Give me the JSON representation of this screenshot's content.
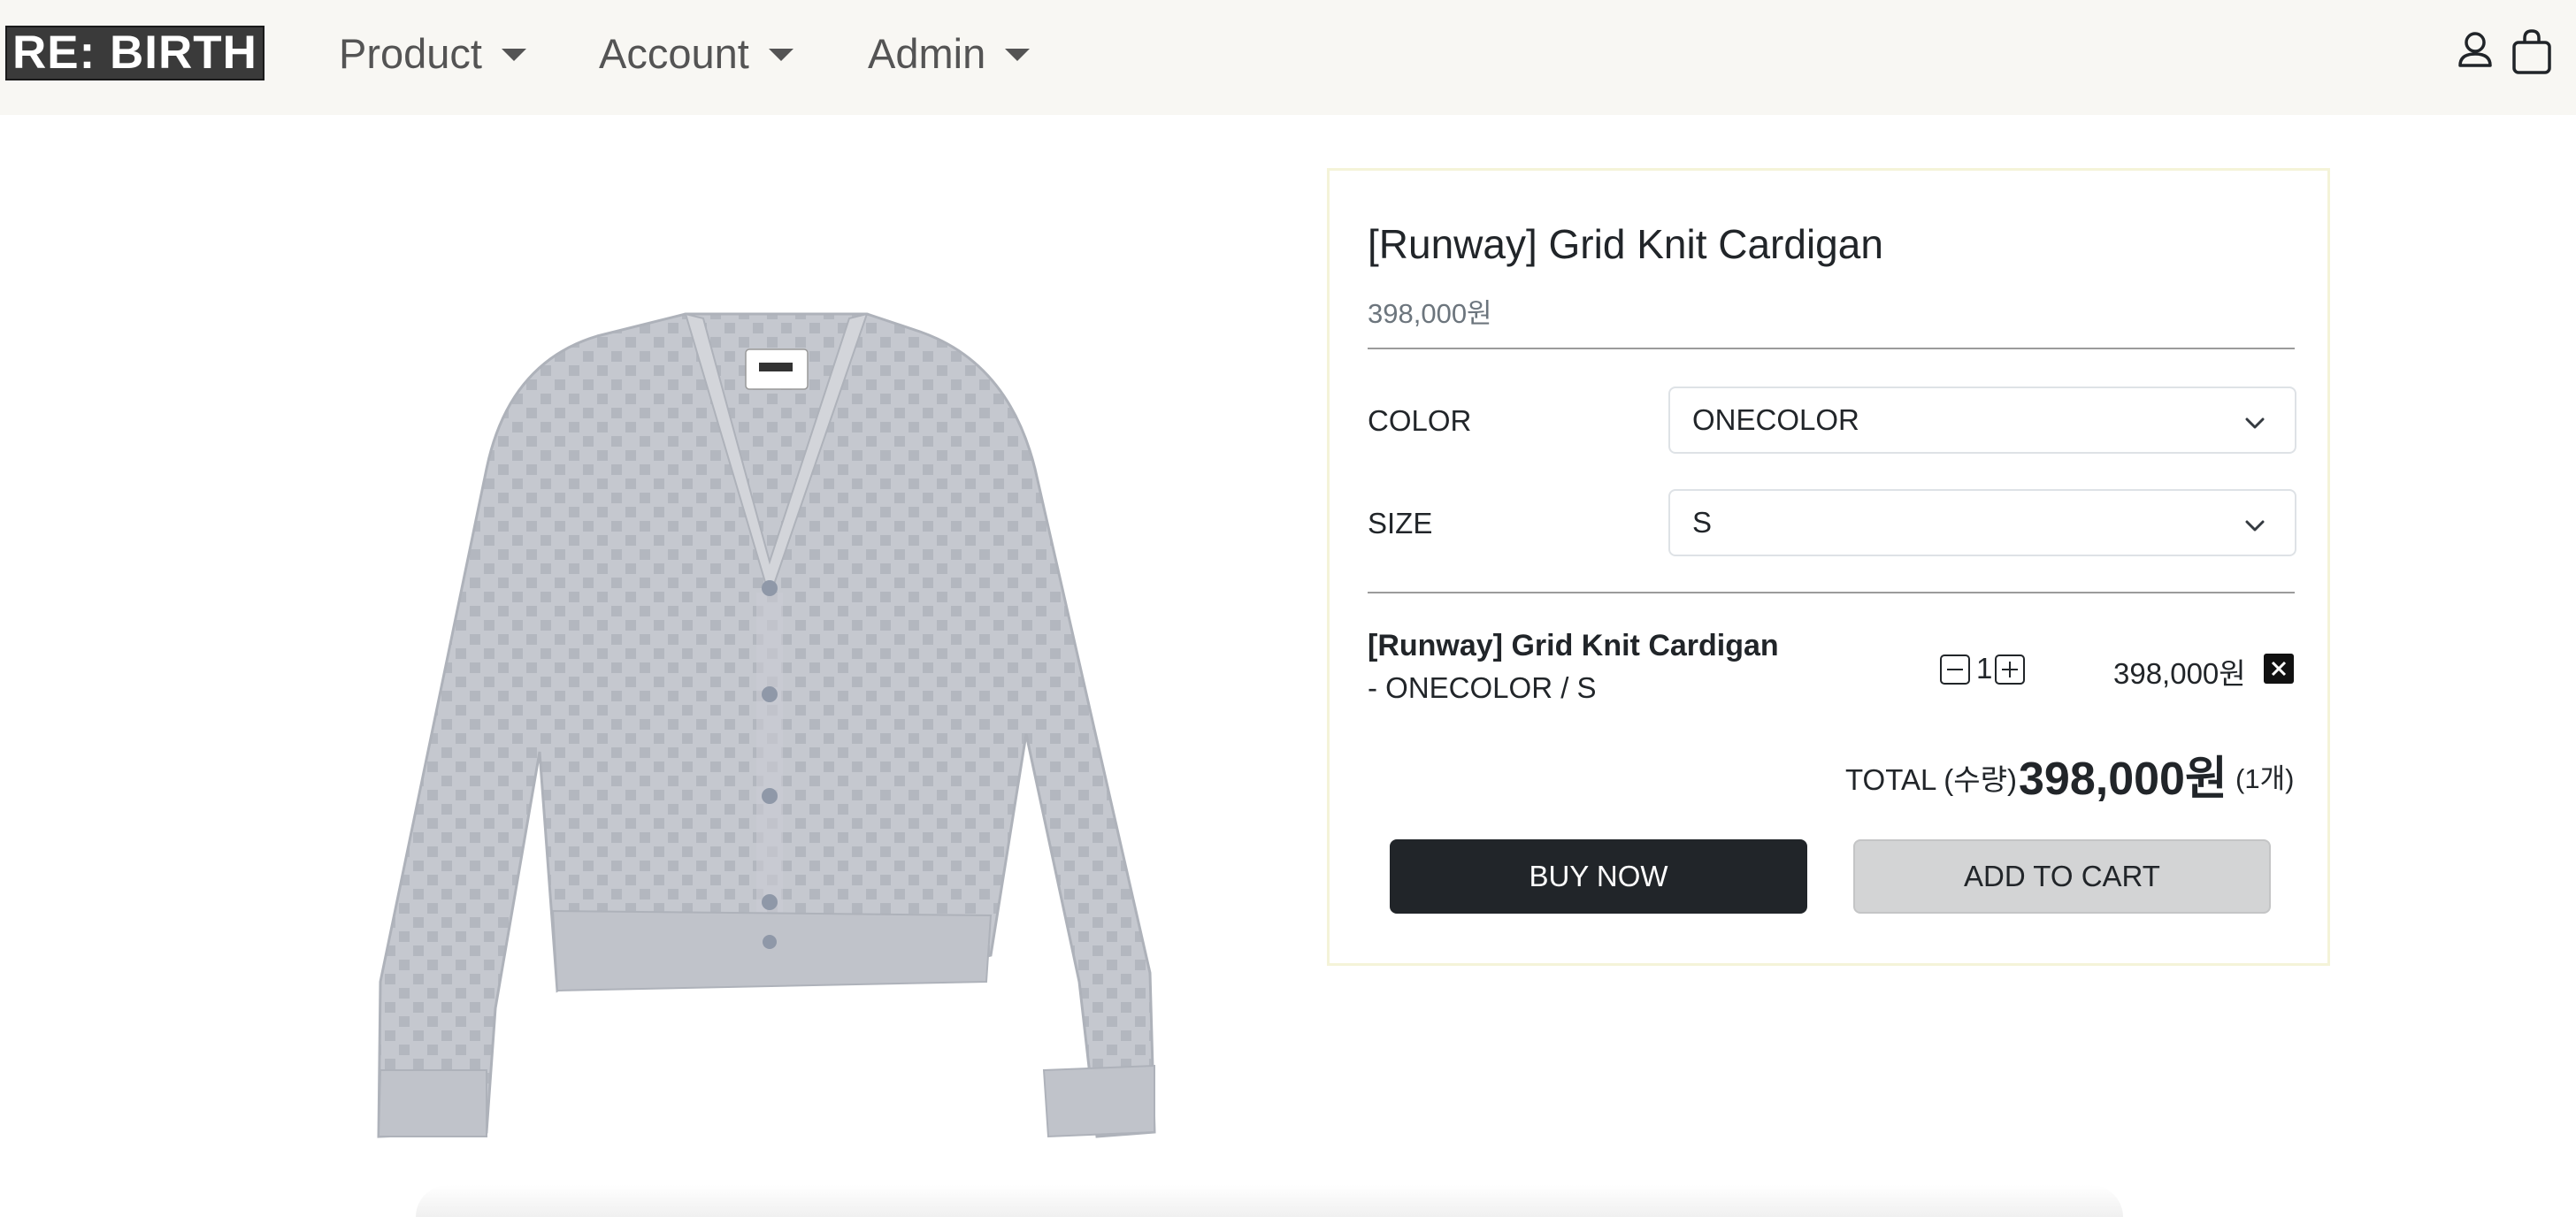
{
  "navbar": {
    "brand": "RE: BIRTH",
    "menu": [
      {
        "label": "Product"
      },
      {
        "label": "Account"
      },
      {
        "label": "Admin"
      }
    ],
    "icons": [
      "user-icon",
      "shopping-bag-icon"
    ]
  },
  "product": {
    "title": "[Runway] Grid Knit Cardigan",
    "price": "398,000원",
    "image_icon": "cardigan-product-image",
    "image_color": "#c5c8cf"
  },
  "options": {
    "color": {
      "label": "COLOR",
      "selected": "ONECOLOR"
    },
    "size": {
      "label": "SIZE",
      "selected": "S"
    }
  },
  "selected_item": {
    "name": "[Runway] Grid Knit Cardigan",
    "variant": "- ONECOLOR / S",
    "quantity": "1",
    "price": "398,000원"
  },
  "total": {
    "label": "TOTAL (수량)",
    "price": "398,000원",
    "count": "(1개)"
  },
  "buttons": {
    "buy_now": "BUY NOW",
    "add_to_cart": "ADD TO CART"
  },
  "colors": {
    "navbar_bg": "#f8f7f3",
    "primary_dark": "#212529",
    "secondary": "#d3d4d5",
    "panel_border": "#f4f3d8"
  }
}
